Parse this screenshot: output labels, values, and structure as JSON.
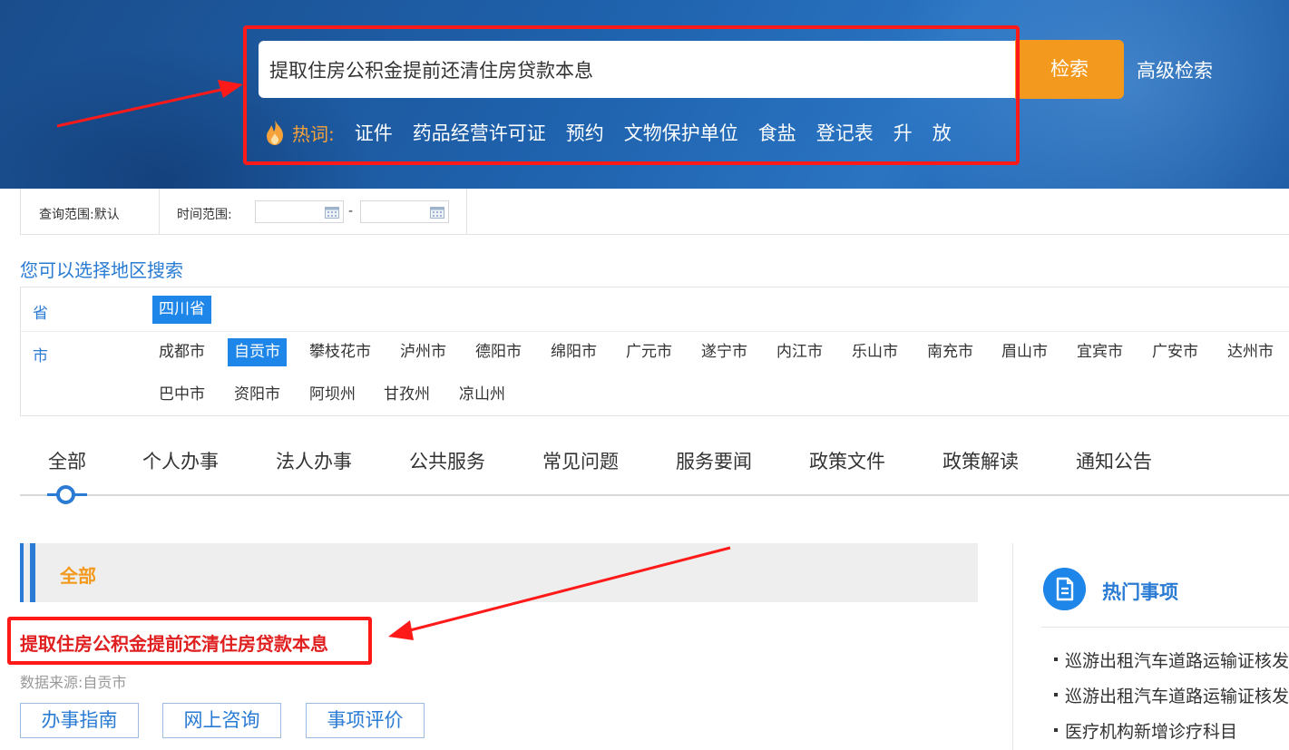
{
  "header": {
    "search_value": "提取住房公积金提前还清住房贷款本息",
    "search_button": "检索",
    "advanced_search": "高级检索",
    "hot_label": "热词:",
    "hot_words": [
      "证件",
      "药品经营许可证",
      "预约",
      "文物保护单位",
      "食盐",
      "登记表",
      "升",
      "放"
    ]
  },
  "filters": {
    "scope": "查询范围:默认",
    "time_range": "时间范围:",
    "date_separator": "-"
  },
  "region": {
    "title": "您可以选择地区搜索",
    "province_label": "省",
    "provinces": [
      "四川省"
    ],
    "city_label": "市",
    "cities": [
      "成都市",
      "自贡市",
      "攀枝花市",
      "泸州市",
      "德阳市",
      "绵阳市",
      "广元市",
      "遂宁市",
      "内江市",
      "乐山市",
      "南充市",
      "眉山市",
      "宜宾市",
      "广安市",
      "达州市",
      "巴中市",
      "资阳市",
      "阿坝州",
      "甘孜州",
      "凉山州"
    ],
    "selected_province": "四川省",
    "selected_city": "自贡市"
  },
  "tabs": [
    "全部",
    "个人办事",
    "法人办事",
    "公共服务",
    "常见问题",
    "服务要闻",
    "政策文件",
    "政策解读",
    "通知公告"
  ],
  "results": {
    "section_title": "全部",
    "item_title": "提取住房公积金提前还清住房贷款本息",
    "item_source": "数据来源:自贡市",
    "buttons": [
      "办事指南",
      "网上咨询",
      "事项评价"
    ]
  },
  "hot_items": {
    "title": "热门事项",
    "items": [
      "巡游出租汽车道路运输证核发",
      "巡游出租汽车道路运输证核发",
      "医疗机构新增诊疗科目"
    ]
  },
  "colors": {
    "accent_blue": "#2a7bd3",
    "search_orange": "#f39a1e",
    "annotation_red": "#ff1a1a",
    "result_red": "#e02020"
  }
}
